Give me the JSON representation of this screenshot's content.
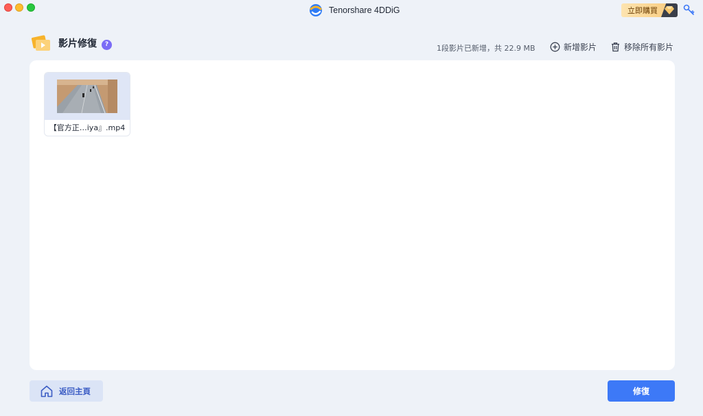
{
  "window": {
    "app_name": "Tenorshare 4DDiG",
    "buy_label": "立即購買"
  },
  "header": {
    "title": "影片修復",
    "help": "?",
    "status": "1段影片已新增，共 22.9 MB",
    "add_label": "新增影片",
    "remove_all_label": "移除所有影片"
  },
  "videos": [
    {
      "name": "【官方正…iya』.mp4"
    }
  ],
  "footer": {
    "home_label": "返回主頁",
    "repair_label": "修復"
  },
  "colors": {
    "accent": "#3d79f7",
    "help_badge": "#7b6cf6",
    "buy_gradient_start": "#fde4b0",
    "buy_gradient_end": "#f8c97a"
  }
}
